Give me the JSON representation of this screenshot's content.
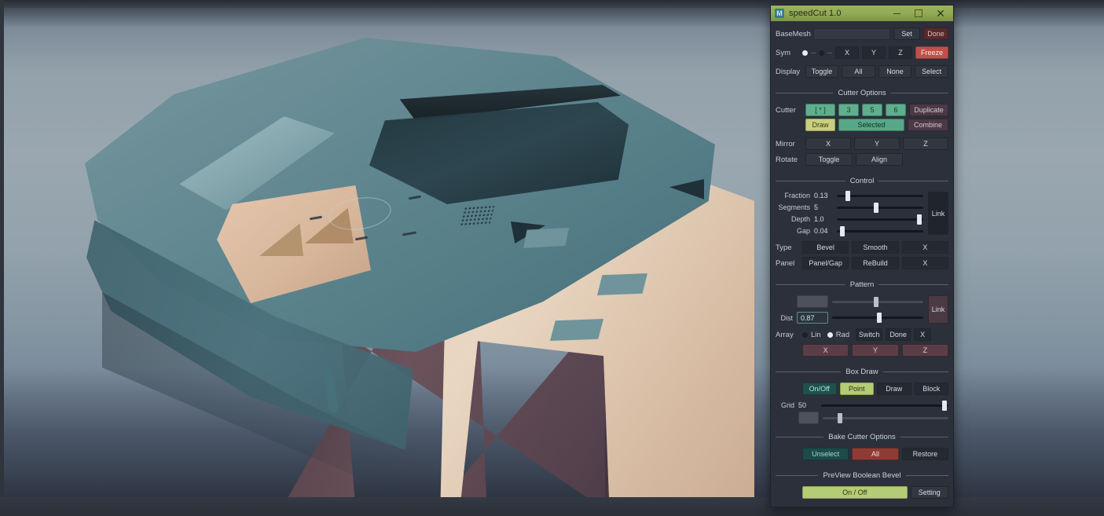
{
  "window": {
    "title": "speedCut 1.0",
    "icon": "M",
    "icon_name": "app-icon",
    "minimize": "–",
    "maximize": "□",
    "close": "✕",
    "titlebar_color": "#95ad57"
  },
  "basemesh": {
    "label": "BaseMesh",
    "field_value": "",
    "set": "Set",
    "done": "Done"
  },
  "sym": {
    "label": "Sym",
    "radio1_on": true,
    "radio2_on": false,
    "x": "X",
    "y": "Y",
    "z": "Z",
    "freeze": "Freeze"
  },
  "display": {
    "label": "Display",
    "toggle": "Toggle",
    "all": "All",
    "none": "None",
    "select": "Select"
  },
  "cutter_options": {
    "section": "Cutter Options",
    "label": "Cutter",
    "count_star": "[ * ]",
    "count_3": "3",
    "count_5": "5",
    "count_6": "6",
    "duplicate": "Duplicate",
    "draw": "Draw",
    "selected": "Selected",
    "combine": "Combine"
  },
  "mirror": {
    "label": "Mirror",
    "x": "X",
    "y": "Y",
    "z": "Z"
  },
  "rotate": {
    "label": "Rotate",
    "toggle": "Toggle",
    "align": "Align"
  },
  "control": {
    "section": "Control",
    "link": "Link",
    "sliders": [
      {
        "label": "Fraction",
        "value": "0.13",
        "pct": 13
      },
      {
        "label": "Segments",
        "value": "5",
        "pct": 45
      },
      {
        "label": "Depth",
        "value": "1.0",
        "pct": 95
      },
      {
        "label": "Gap",
        "value": "0.04",
        "pct": 6
      }
    ],
    "type_label": "Type",
    "type_bevel": "Bevel",
    "type_smooth": "Smooth",
    "type_x": "X",
    "panel_label": "Panel",
    "panel_gap": "Panel/Gap",
    "panel_rebuild": "ReBuild",
    "panel_x": "X"
  },
  "pattern": {
    "section": "Pattern",
    "link": "Link",
    "top_field_disabled": true,
    "top_slider_pct": 48,
    "dist_label": "Dist",
    "dist_value": "0.87",
    "dist_slider_pct": 52,
    "array_label": "Array",
    "lin": "Lin",
    "lin_on": false,
    "rad": "Rad",
    "rad_on": true,
    "switch": "Switch",
    "done": "Done",
    "x_small": "X",
    "axis_x": "X",
    "axis_y": "Y",
    "axis_z": "Z"
  },
  "box_draw": {
    "section": "Box Draw",
    "onoff": "On/Off",
    "point": "Point",
    "draw": "Draw",
    "block": "Block",
    "grid_label": "Grid",
    "grid_value": "50",
    "grid_pct": 97,
    "sub_slider_pct": 14
  },
  "bake": {
    "section": "Bake Cutter Options",
    "unselect": "Unselect",
    "all": "All",
    "restore": "Restore"
  },
  "preview": {
    "section": "PreView Boolean Bevel",
    "onoff": "On / Off",
    "setting": "Setting"
  }
}
